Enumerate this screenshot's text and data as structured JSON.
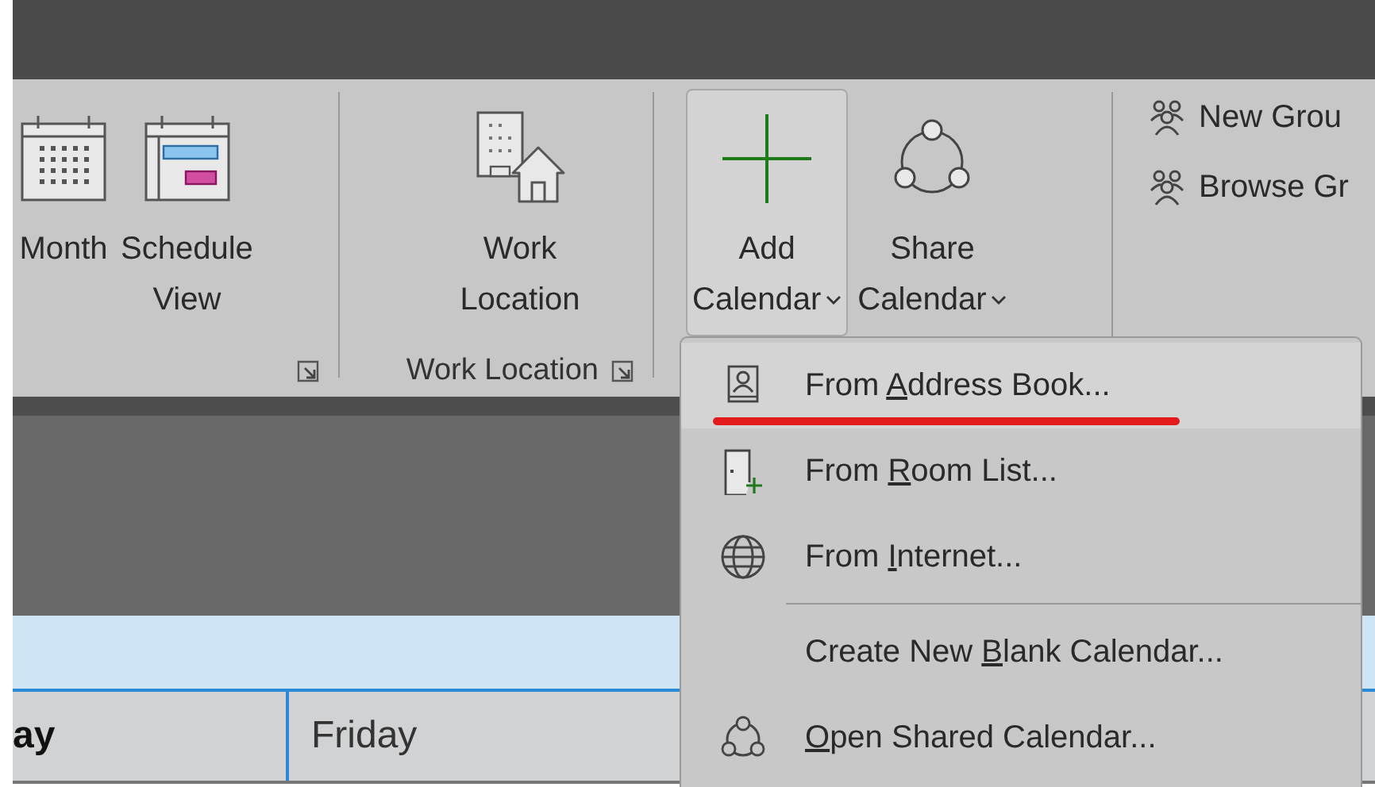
{
  "ribbon": {
    "groups": [
      {
        "kind": "large",
        "launcher": true,
        "buttons": [
          {
            "kind": "month",
            "label_lines": [
              "Month"
            ],
            "dropdown": false,
            "pressed": false
          },
          {
            "kind": "schedule",
            "label_lines": [
              "Schedule",
              "View"
            ],
            "dropdown": false,
            "pressed": false
          }
        ]
      },
      {
        "kind": "large",
        "label": "Work Location",
        "launcher": true,
        "buttons": [
          {
            "kind": "work-location",
            "label_lines": [
              "Work",
              "Location"
            ],
            "dropdown": false,
            "pressed": false
          }
        ]
      },
      {
        "kind": "large",
        "launcher": false,
        "buttons": [
          {
            "kind": "add",
            "label_lines": [
              "Add",
              "Calendar"
            ],
            "dropdown": true,
            "pressed": true
          },
          {
            "kind": "share",
            "label_lines": [
              "Share",
              "Calendar"
            ],
            "dropdown": true,
            "pressed": false
          }
        ]
      },
      {
        "kind": "small",
        "launcher": false,
        "buttons": [
          {
            "label": "New Grou"
          },
          {
            "label": "Browse Gr"
          }
        ]
      }
    ]
  },
  "calendar": {
    "day_headers": [
      {
        "label": "ay",
        "today": true
      },
      {
        "label": "Friday",
        "today": false
      }
    ]
  },
  "menu": {
    "items": [
      {
        "kind": "address-book",
        "before": "From ",
        "key": "A",
        "after": "ddress Book...",
        "selected": true,
        "annotated": true
      },
      {
        "kind": "room-list",
        "before": "From ",
        "key": "R",
        "after": "oom List...",
        "selected": false,
        "annotated": false
      },
      {
        "kind": "internet",
        "before": "From ",
        "key": "I",
        "after": "nternet...",
        "selected": false,
        "annotated": false
      },
      {
        "kind": "separator"
      },
      {
        "kind": "plain",
        "before": "Create New ",
        "key": "B",
        "after": "lank Calendar...",
        "selected": false,
        "annotated": false
      },
      {
        "kind": "shared",
        "key": "O",
        "after": "pen Shared Calendar...",
        "selected": false,
        "annotated": false
      }
    ]
  }
}
